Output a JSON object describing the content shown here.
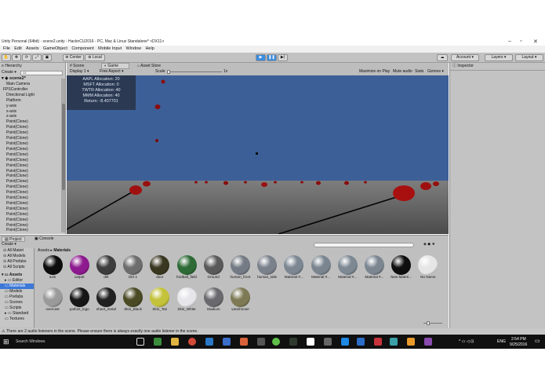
{
  "window": {
    "title": "Unity Personal (64bit) - scene2.unity - HacknCU2016 - PC, Mac & Linux Standalone* <DX11>"
  },
  "menu": [
    "File",
    "Edit",
    "Assets",
    "GameObject",
    "Component",
    "Mobile Input",
    "Window",
    "Help"
  ],
  "toolbar": {
    "center_label": "Center",
    "local_label": "Local",
    "account_label": "Account",
    "layers_label": "Layers",
    "layout_label": "Layout"
  },
  "hierarchy": {
    "tab": "Hierarchy",
    "create_label": "Create",
    "search_placeholder": "All",
    "scene_name": "scene2*",
    "items": [
      "Main Camera",
      "FPSController",
      "Directional Light",
      "Platform",
      "y-axis",
      "x-axis",
      "z-axis",
      "Point(Clone)",
      "Point(Clone)",
      "Point(Clone)",
      "Point(Clone)",
      "Point(Clone)",
      "Point(Clone)",
      "Point(Clone)",
      "Point(Clone)",
      "Point(Clone)",
      "Point(Clone)",
      "Point(Clone)",
      "Point(Clone)",
      "Point(Clone)",
      "Point(Clone)",
      "Point(Clone)",
      "Point(Clone)",
      "Point(Clone)",
      "Point(Clone)",
      "Point(Clone)",
      "Point(Clone)",
      "Point(Clone)"
    ]
  },
  "game_view": {
    "tabs": [
      "Scene",
      "Game",
      "Asset Store"
    ],
    "display_label": "Display 1",
    "aspect_label": "Free Aspect",
    "scale_label": "Scale",
    "scale_value": "1x",
    "maximize_label": "Maximize on Play",
    "mute_label": "Mute audio",
    "stats_label": "Stats",
    "gizmos_label": "Gizmos",
    "overlay": [
      "AAPL Allocation: 20",
      "MSFT Allocation: 0",
      "TWTR Allocation: 40",
      "MMM Allocation: 40",
      "Return: -8.407701"
    ]
  },
  "inspector": {
    "tab": "Inspector"
  },
  "project": {
    "tabs": [
      "Project",
      "Console"
    ],
    "create_label": "Create",
    "breadcrumb": [
      "Assets",
      "Materials"
    ],
    "tree": [
      "All Materi",
      "All Models",
      "All Prefabs",
      "All Scripts",
      "Assets",
      "Editor",
      "Materials",
      "Models",
      "Prefabs",
      "Scenes",
      "Scripts",
      "Standard",
      "Textures"
    ],
    "materials": [
      {
        "name": "axis",
        "color": "#0c0c0c"
      },
      {
        "name": "carpet",
        "color": "#8d1a8f"
      },
      {
        "name": "dirt",
        "color": "#3d3d3d"
      },
      {
        "name": "Dirt 1",
        "color": "#6d6d6d"
      },
      {
        "name": "door",
        "color": "#3a3720"
      },
      {
        "name": "football_field",
        "color": "#2d6a35"
      },
      {
        "name": "Ground",
        "color": "#5a5a5a"
      },
      {
        "name": "human_front",
        "color": "#757b84"
      },
      {
        "name": "human_side",
        "color": "#7b818b"
      },
      {
        "name": "Material #...",
        "color": "#7c8792"
      },
      {
        "name": "Material #...",
        "color": "#7a8590"
      },
      {
        "name": "Material #...",
        "color": "#7d8893"
      },
      {
        "name": "Material #...",
        "color": "#7b8691"
      },
      {
        "name": "New Materi...",
        "color": "#0f0f0f"
      },
      {
        "name": "No Name",
        "color": "#e6e6e6"
      },
      {
        "name": "overcast",
        "color": "#9a9a9a"
      },
      {
        "name": "pathos_logo",
        "color": "#161616"
      },
      {
        "name": "sheet_metal",
        "color": "#202020"
      },
      {
        "name": "Skin_Black",
        "color": "#4a4a24"
      },
      {
        "name": "Skin_Tan",
        "color": "#c3c23a"
      },
      {
        "name": "Skin_White",
        "color": "#e6e6ea"
      },
      {
        "name": "Stadium",
        "color": "#6a6a6e"
      },
      {
        "name": "vanehnose",
        "color": "#7d7a55"
      }
    ]
  },
  "status": "There are 2 audio listeners in the scene. Please ensure there is always exactly one audio listener in the scene.",
  "taskbar": {
    "search_placeholder": "Search Windows",
    "language": "ENG",
    "time": "2:54 PM",
    "date": "9/25/2016"
  },
  "colors": {
    "sky": "#3c5f97",
    "point": "#b01010",
    "accent": "#3c8dde"
  }
}
